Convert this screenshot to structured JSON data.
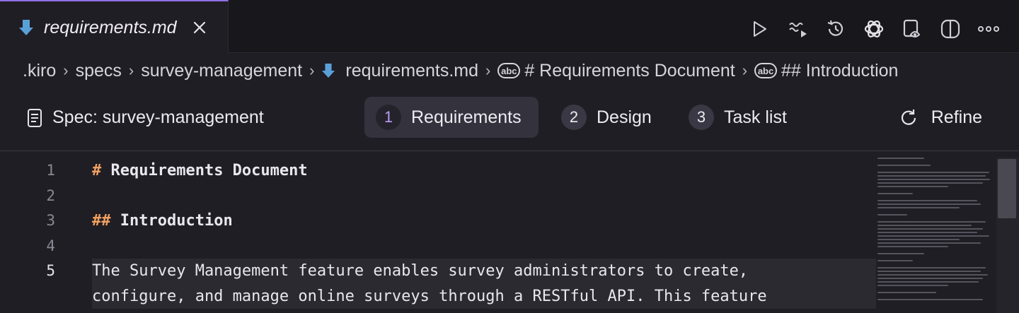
{
  "tab": {
    "title": "requirements.md"
  },
  "toolbar": {
    "icons": [
      "play-icon",
      "voice-icon",
      "history-icon",
      "openai-icon",
      "preview-icon",
      "split-editor-icon",
      "more-icon"
    ]
  },
  "breadcrumb": {
    "items": [
      ".kiro",
      "specs",
      "survey-management",
      "requirements.md",
      "# Requirements Document",
      "## Introduction"
    ],
    "symbol_label": "abc"
  },
  "spec": {
    "title": "Spec: survey-management",
    "steps": [
      {
        "num": "1",
        "label": "Requirements",
        "active": true
      },
      {
        "num": "2",
        "label": "Design",
        "active": false
      },
      {
        "num": "3",
        "label": "Task list",
        "active": false
      }
    ],
    "refine_label": "Refine"
  },
  "editor": {
    "line_numbers": [
      "1",
      "2",
      "3",
      "4",
      "5",
      ""
    ],
    "lines": [
      {
        "hash": "#",
        "text": " Requirements Document"
      },
      {
        "hash": "",
        "text": ""
      },
      {
        "hash": "##",
        "text": " Introduction"
      },
      {
        "hash": "",
        "text": ""
      },
      {
        "hash": "",
        "text": "The Survey Management feature enables survey administrators to create,"
      },
      {
        "hash": "",
        "text": "configure, and manage online surveys through a RESTful API. This feature"
      }
    ]
  },
  "colors": {
    "accent": "#8f6fe8",
    "heading_hash": "#f0a061",
    "background": "#1f1e24"
  }
}
